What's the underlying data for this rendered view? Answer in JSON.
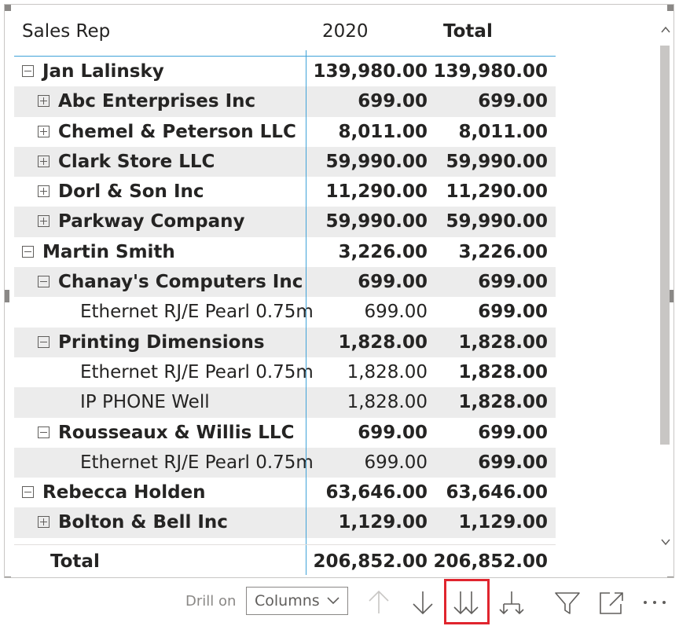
{
  "matrix": {
    "headers": {
      "rep": "Sales Rep",
      "year": "2020",
      "total": "Total"
    },
    "rows": [
      {
        "level": 0,
        "toggle": "minus",
        "label": "Jan Lalinsky",
        "v2020": "139,980.00",
        "total": "139,980.00",
        "bold": true,
        "shade": false
      },
      {
        "level": 1,
        "toggle": "plus",
        "label": "Abc Enterprises Inc",
        "v2020": "699.00",
        "total": "699.00",
        "bold": true,
        "shade": true
      },
      {
        "level": 1,
        "toggle": "plus",
        "label": "Chemel & Peterson LLC",
        "v2020": "8,011.00",
        "total": "8,011.00",
        "bold": true,
        "shade": false
      },
      {
        "level": 1,
        "toggle": "plus",
        "label": "Clark Store LLC",
        "v2020": "59,990.00",
        "total": "59,990.00",
        "bold": true,
        "shade": true
      },
      {
        "level": 1,
        "toggle": "plus",
        "label": "Dorl & Son Inc",
        "v2020": "11,290.00",
        "total": "11,290.00",
        "bold": true,
        "shade": false
      },
      {
        "level": 1,
        "toggle": "plus",
        "label": "Parkway Company",
        "v2020": "59,990.00",
        "total": "59,990.00",
        "bold": true,
        "shade": true
      },
      {
        "level": 0,
        "toggle": "minus",
        "label": "Martin Smith",
        "v2020": "3,226.00",
        "total": "3,226.00",
        "bold": true,
        "shade": false
      },
      {
        "level": 1,
        "toggle": "minus",
        "label": "Chanay's Computers Inc",
        "v2020": "699.00",
        "total": "699.00",
        "bold": true,
        "shade": true
      },
      {
        "level": 2,
        "toggle": "",
        "label": "Ethernet RJ/E Pearl 0.75m",
        "v2020": "699.00",
        "total": "699.00",
        "bold": false,
        "shade": false
      },
      {
        "level": 1,
        "toggle": "minus",
        "label": "Printing Dimensions",
        "v2020": "1,828.00",
        "total": "1,828.00",
        "bold": true,
        "shade": true
      },
      {
        "level": 2,
        "toggle": "",
        "label": "Ethernet RJ/E Pearl 0.75m",
        "v2020": "1,828.00",
        "total": "1,828.00",
        "bold": false,
        "shade": false
      },
      {
        "level": 2,
        "toggle": "",
        "label": "IP PHONE Well",
        "v2020": "1,828.00",
        "total": "1,828.00",
        "bold": false,
        "shade": true
      },
      {
        "level": 1,
        "toggle": "minus",
        "label": "Rousseaux & Willis LLC",
        "v2020": "699.00",
        "total": "699.00",
        "bold": true,
        "shade": false
      },
      {
        "level": 2,
        "toggle": "",
        "label": "Ethernet RJ/E Pearl 0.75m",
        "v2020": "699.00",
        "total": "699.00",
        "bold": false,
        "shade": true
      },
      {
        "level": 0,
        "toggle": "minus",
        "label": "Rebecca Holden",
        "v2020": "63,646.00",
        "total": "63,646.00",
        "bold": true,
        "shade": false
      },
      {
        "level": 1,
        "toggle": "plus",
        "label": "Bolton & Bell Inc",
        "v2020": "1,129.00",
        "total": "1,129.00",
        "bold": true,
        "shade": true
      }
    ],
    "grand_total": {
      "label": "Total",
      "v2020": "206,852.00",
      "total": "206,852.00"
    }
  },
  "scrollbar": {
    "up_icon": "chevron-up-icon",
    "down_icon": "chevron-down-icon"
  },
  "toolbar": {
    "drill_label": "Drill on",
    "drill_value": "Columns",
    "icons": [
      "drill-up-icon",
      "drill-down-icon",
      "expand-all-icon",
      "expand-next-level-icon",
      "filter-icon",
      "focus-mode-icon",
      "more-options-icon"
    ],
    "highlight_color": "#e0252e"
  },
  "colors": {
    "accent_line": "#3fa2d8",
    "row_shade": "#ececec"
  }
}
